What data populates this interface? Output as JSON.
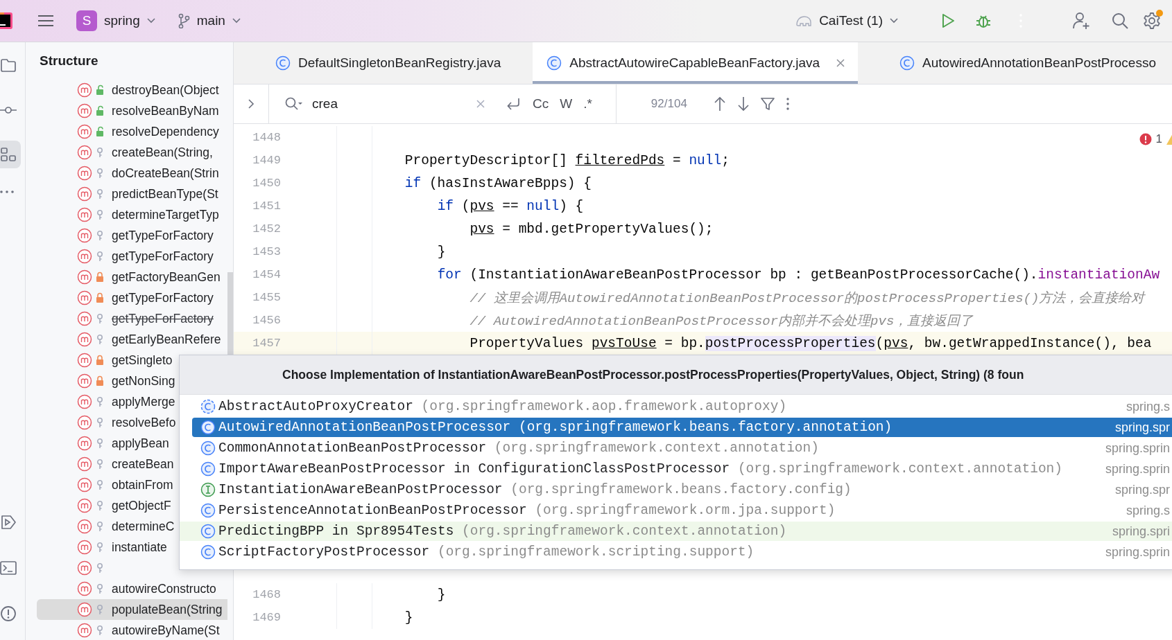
{
  "top_bar": {
    "project": {
      "badge": "S",
      "name": "spring"
    },
    "branch": "main",
    "run_config": "CaiTest (1)",
    "settings_notification": true
  },
  "tool_strip": {
    "items": [
      {
        "kind": "project",
        "selected": false
      },
      {
        "kind": "commit",
        "selected": false
      },
      {
        "kind": "structure",
        "selected": true
      },
      {
        "kind": "more",
        "selected": false
      },
      {
        "kind": "run",
        "selected": false
      },
      {
        "kind": "terminal",
        "selected": false
      },
      {
        "kind": "problems",
        "selected": false
      }
    ]
  },
  "structure": {
    "title": "Structure",
    "items": [
      {
        "name": "destroyBean(Object",
        "kind": "public",
        "deprecated": false,
        "selected": false
      },
      {
        "name": "resolveBeanByNam",
        "kind": "public",
        "deprecated": false,
        "selected": false
      },
      {
        "name": "resolveDependency",
        "kind": "public",
        "deprecated": false,
        "selected": false
      },
      {
        "name": "createBean(String, ",
        "kind": "protected",
        "deprecated": false,
        "selected": false
      },
      {
        "name": "doCreateBean(Strin",
        "kind": "protected",
        "deprecated": false,
        "selected": false
      },
      {
        "name": "predictBeanType(St",
        "kind": "protected",
        "deprecated": false,
        "selected": false
      },
      {
        "name": "determineTargetTyp",
        "kind": "protected",
        "deprecated": false,
        "selected": false
      },
      {
        "name": "getTypeForFactory",
        "kind": "protected",
        "deprecated": false,
        "selected": false
      },
      {
        "name": "getTypeForFactory",
        "kind": "protected",
        "deprecated": false,
        "selected": false
      },
      {
        "name": "getFactoryBeanGen",
        "kind": "private",
        "deprecated": false,
        "selected": false
      },
      {
        "name": "getTypeForFactory",
        "kind": "private",
        "deprecated": false,
        "selected": false
      },
      {
        "name": "getTypeForFactory",
        "kind": "protected",
        "deprecated": true,
        "selected": false
      },
      {
        "name": "getEarlyBeanRefere",
        "kind": "protected",
        "deprecated": false,
        "selected": false
      },
      {
        "name": "getSingleto",
        "kind": "private",
        "deprecated": false,
        "selected": false
      },
      {
        "name": "getNonSing",
        "kind": "private",
        "deprecated": false,
        "selected": false
      },
      {
        "name": "applyMerge",
        "kind": "protected",
        "deprecated": false,
        "selected": false
      },
      {
        "name": "resolveBefo",
        "kind": "protected",
        "deprecated": false,
        "selected": false
      },
      {
        "name": "applyBean",
        "kind": "protected",
        "deprecated": false,
        "selected": false
      },
      {
        "name": "createBean",
        "kind": "protected",
        "deprecated": false,
        "selected": false
      },
      {
        "name": "obtainFrom",
        "kind": "protected",
        "deprecated": false,
        "selected": false
      },
      {
        "name": "getObjectF",
        "kind": "protected",
        "deprecated": false,
        "selected": false
      },
      {
        "name": "determineC",
        "kind": "protected",
        "deprecated": false,
        "selected": false
      },
      {
        "name": "instantiate",
        "kind": "protected",
        "deprecated": false,
        "selected": false
      },
      {
        "kind": "protected",
        "deprecated": false,
        "selected": false
      },
      {
        "name": "autowireConstructo",
        "kind": "protected",
        "deprecated": false,
        "selected": false
      },
      {
        "name": "populateBean(String",
        "kind": "protected",
        "deprecated": false,
        "selected": true
      },
      {
        "name": "autowireByName(St",
        "kind": "protected",
        "deprecated": false,
        "selected": false
      }
    ]
  },
  "editor": {
    "tabs": [
      {
        "label": "DefaultSingletonBeanRegistry.java",
        "selected": false
      },
      {
        "label": "AbstractAutowireCapableBeanFactory.java",
        "selected": true,
        "closable": true
      },
      {
        "label": "AutowiredAnnotationBeanPostProcesso",
        "selected": false
      }
    ],
    "find": {
      "value": "crea",
      "toggles": [
        "Cc",
        "W",
        ".*"
      ],
      "count": "92/104"
    },
    "inspections": {
      "errors": "1"
    },
    "code_above": [
      {
        "number": "1448",
        "current": false
      },
      {
        "number": "1449",
        "current": false,
        "tokens": [
          {
            "kind": "plain",
            "text": "    PropertyDescriptor[] "
          },
          {
            "kind": "var",
            "text": "filteredPds"
          },
          {
            "kind": "plain",
            "text": " = "
          },
          {
            "kind": "keyword",
            "text": "null"
          },
          {
            "kind": "plain",
            "text": ";"
          }
        ]
      },
      {
        "number": "1450",
        "current": false,
        "tokens": [
          {
            "kind": "keyword",
            "text": "    if"
          },
          {
            "kind": "plain",
            "text": " (hasInstAwareBpps) {"
          }
        ]
      },
      {
        "number": "1451",
        "current": false,
        "tokens": [
          {
            "kind": "keyword",
            "text": "        if"
          },
          {
            "kind": "plain",
            "text": " ("
          },
          {
            "kind": "var",
            "text": "pvs"
          },
          {
            "kind": "plain",
            "text": " == "
          },
          {
            "kind": "keyword",
            "text": "null"
          },
          {
            "kind": "plain",
            "text": ") {"
          }
        ]
      },
      {
        "number": "1452",
        "current": false,
        "tokens": [
          {
            "kind": "var",
            "text": "            pvs"
          },
          {
            "kind": "plain",
            "text": " = mbd.getPropertyValues();"
          }
        ]
      },
      {
        "number": "1453",
        "current": false,
        "tokens": [
          {
            "kind": "plain",
            "text": "        }"
          }
        ]
      },
      {
        "number": "1454",
        "current": false,
        "tokens": [
          {
            "kind": "keyword",
            "text": "        for"
          },
          {
            "kind": "plain",
            "text": " (InstantiationAwareBeanPostProcessor bp : getBeanPostProcessorCache()."
          },
          {
            "kind": "field",
            "text": "instantiationAw"
          }
        ]
      },
      {
        "number": "1455",
        "current": false,
        "tokens": [
          {
            "kind": "comment",
            "text": "            // 这里会调用AutowiredAnnotationBeanPostProcessor的postProcessProperties()方法，会直接给对"
          }
        ]
      },
      {
        "number": "1456",
        "current": false,
        "tokens": [
          {
            "kind": "comment",
            "text": "            // AutowiredAnnotationBeanPostProcessor内部并不会处理pvs，直接返回了"
          }
        ]
      },
      {
        "number": "1457",
        "current": true,
        "tokens": [
          {
            "kind": "plain",
            "text": "            PropertyValues "
          },
          {
            "kind": "var",
            "text": "pvsToUse"
          },
          {
            "kind": "plain",
            "text": " = bp."
          },
          {
            "kind": "highlight",
            "text": "postProcessProperties"
          },
          {
            "kind": "plain",
            "text": "("
          },
          {
            "kind": "var",
            "text": "pvs"
          },
          {
            "kind": "plain",
            "text": ", bw.getWrappedInstance(), bea"
          }
        ]
      }
    ],
    "code_below": [
      {
        "number": "1468",
        "current": false,
        "tokens": [
          {
            "kind": "plain",
            "text": "        }"
          }
        ]
      },
      {
        "number": "1469",
        "current": false,
        "tokens": [
          {
            "kind": "plain",
            "text": "    }"
          }
        ]
      }
    ]
  },
  "popup": {
    "title": "Choose Implementation of InstantiationAwareBeanPostProcessor.postProcessProperties(PropertyValues, Object, String) (8 foun",
    "items": [
      {
        "kind": "abstract",
        "name": "AbstractAutoProxyCreator",
        "package": "(org.springframework.aop.framework.autoproxy)",
        "module": "spring.s",
        "selected": false,
        "test": false
      },
      {
        "kind": "class",
        "name": "AutowiredAnnotationBeanPostProcessor",
        "package": "(org.springframework.beans.factory.annotation)",
        "module": "spring.spr",
        "selected": true,
        "test": false
      },
      {
        "kind": "class",
        "name": "CommonAnnotationBeanPostProcessor",
        "package": "(org.springframework.context.annotation)",
        "module": "spring.sprin",
        "selected": false,
        "test": false
      },
      {
        "kind": "class",
        "name": "ImportAwareBeanPostProcessor in ConfigurationClassPostProcessor",
        "package": "(org.springframework.context.annotation)",
        "module": "spring.sprin",
        "selected": false,
        "test": false
      },
      {
        "kind": "interface",
        "name": "InstantiationAwareBeanPostProcessor",
        "package": "(org.springframework.beans.factory.config)",
        "module": "spring.spr",
        "selected": false,
        "test": false
      },
      {
        "kind": "class",
        "name": "PersistenceAnnotationBeanPostProcessor",
        "package": "(org.springframework.orm.jpa.support)",
        "module": "spring.s",
        "selected": false,
        "test": false
      },
      {
        "kind": "class",
        "name": "PredictingBPP in Spr8954Tests",
        "package": "(org.springframework.context.annotation)",
        "module": "spring.spri",
        "selected": false,
        "test": true
      },
      {
        "kind": "class",
        "name": "ScriptFactoryPostProcessor",
        "package": "(org.springframework.scripting.support)",
        "module": "spring.sprin",
        "selected": false,
        "test": false
      }
    ]
  }
}
